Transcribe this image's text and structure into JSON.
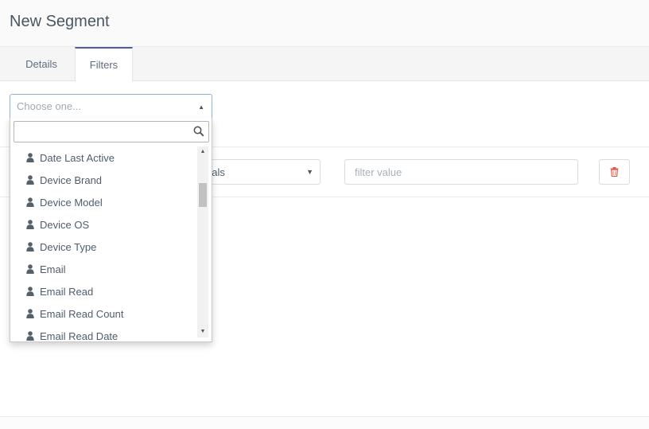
{
  "header": {
    "title": "New Segment"
  },
  "tabs": [
    {
      "label": "Details",
      "active": false
    },
    {
      "label": "Filters",
      "active": true
    }
  ],
  "chooser": {
    "placeholder": "Choose one..."
  },
  "dropdown": {
    "search_value": "",
    "options": [
      "Date Last Active",
      "Device Brand",
      "Device Model",
      "Device OS",
      "Device Type",
      "Email",
      "Email Read",
      "Email Read Count",
      "Email Read Date"
    ]
  },
  "filter_row": {
    "operator_visible_text": "uals",
    "value_placeholder": "filter value"
  },
  "icons": {
    "search": "search-icon",
    "option": "user-icon",
    "delete": "trash-icon"
  },
  "colors": {
    "accent_tab": "#4e5d9d",
    "focus_border": "#8ab4de",
    "delete_icon": "#e0584a"
  }
}
